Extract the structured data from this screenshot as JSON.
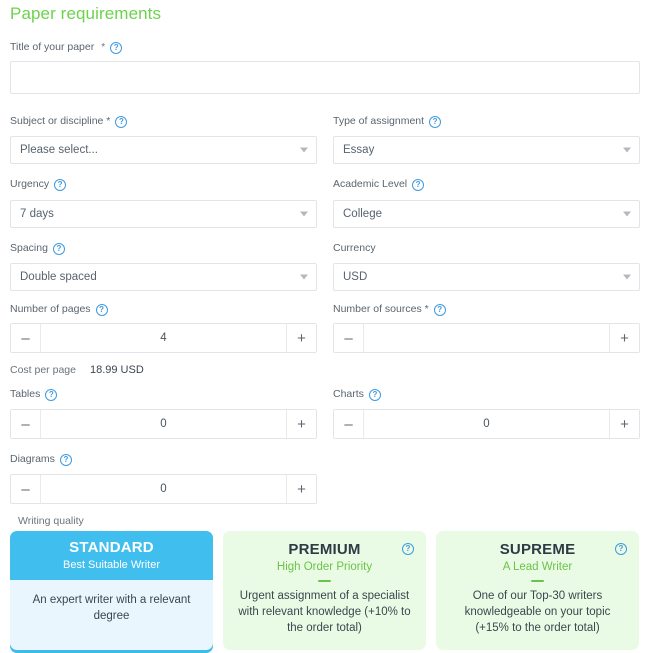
{
  "page": {
    "title": "Paper requirements"
  },
  "icons": {
    "help": "?",
    "minus": "–",
    "plus": "+"
  },
  "fields": {
    "title_of_paper": {
      "label": "Title of your paper",
      "required_mark": "*",
      "value": "",
      "placeholder": ""
    },
    "subject": {
      "label": "Subject or discipline *",
      "value": "Please select..."
    },
    "type_of_assignment": {
      "label": "Type of assignment",
      "value": "Essay"
    },
    "urgency": {
      "label": "Urgency",
      "value": "7 days"
    },
    "academic_level": {
      "label": "Academic Level",
      "value": "College"
    },
    "spacing": {
      "label": "Spacing",
      "value": "Double spaced"
    },
    "currency": {
      "label": "Currency",
      "value": "USD"
    },
    "number_of_pages": {
      "label": "Number of pages",
      "value": "4"
    },
    "number_of_sources": {
      "label": "Number of sources *",
      "value": ""
    },
    "cost_per_page": {
      "label": "Cost per page",
      "value": "18.99 USD"
    },
    "tables": {
      "label": "Tables",
      "value": "0"
    },
    "charts": {
      "label": "Charts",
      "value": "0"
    },
    "diagrams": {
      "label": "Diagrams",
      "value": "0"
    }
  },
  "writing_quality": {
    "label": "Writing quality",
    "cards": [
      {
        "id": "standard",
        "title": "STANDARD",
        "subtitle": "Best Suitable Writer",
        "description": "An expert writer with a relevant degree",
        "selected": true,
        "accent": "#40bfee"
      },
      {
        "id": "premium",
        "title": "PREMIUM",
        "subtitle": "High Order Priority",
        "description": "Urgent assignment of a specialist with relevant knowledge (+10% to the order total)",
        "selected": false,
        "accent": "#6cc24a"
      },
      {
        "id": "supreme",
        "title": "SUPREME",
        "subtitle": "A Lead Writer",
        "description": "One of our Top-30 writers knowledgeable on your topic (+15% to the order total)",
        "selected": false,
        "accent": "#6cc24a"
      }
    ]
  },
  "colors": {
    "title_green": "#6cd34c",
    "help_blue": "#3f9ae0",
    "standard_blue": "#40bfee",
    "standard_body": "#e9f6fe",
    "green_card_bg": "#eafbe5",
    "green_text": "#6cc24a",
    "border": "#e2e4e7"
  }
}
